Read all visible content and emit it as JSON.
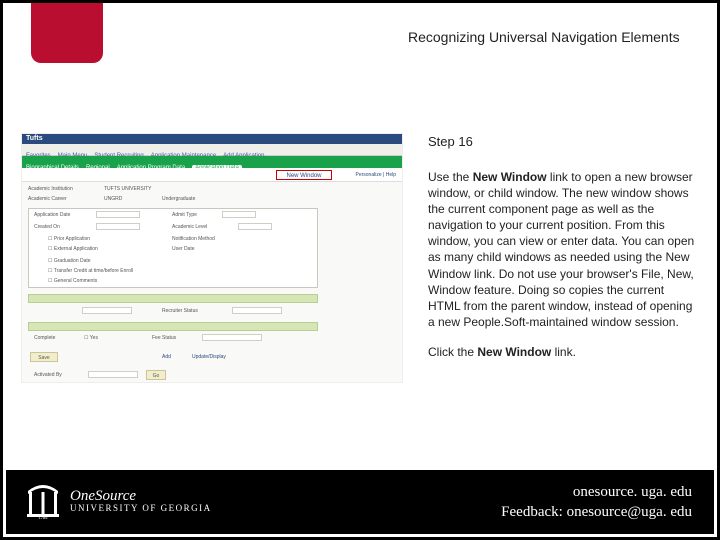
{
  "title": "Recognizing Universal Navigation Elements",
  "step_label": "Step 16",
  "body_html": "Use the <b>New Window</b> link to open a new browser window, or child window. The new window shows the current component page as well as the navigation to your current position. From this window, you can view or enter data. You can open as many child windows as needed using the New Window link. Do not use your browser's File, New, Window feature. Doing so copies the current HTML from the parent window, instead of opening a new People.Soft-maintained window session.",
  "instruction_html": "Click the <b>New Window</b> link.",
  "screenshot": {
    "brand": "Tufts",
    "new_window_label": "New Window",
    "top_links": "Personalize | Help"
  },
  "footer": {
    "logo_line1": "OneSource",
    "logo_line2": "UNIVERSITY OF GEORGIA",
    "url": "onesource. uga. edu",
    "feedback": "Feedback: onesource@uga. edu"
  }
}
